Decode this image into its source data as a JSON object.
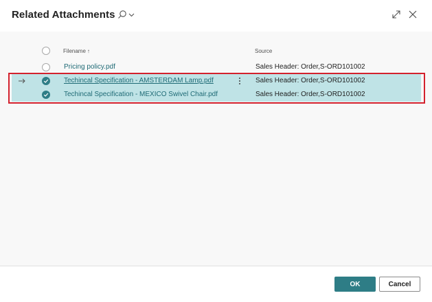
{
  "dialog": {
    "title": "Related Attachments",
    "search_icon": "search-icon",
    "search_dropdown_icon": "chevron-down-icon",
    "expand_icon": "expand-icon",
    "close_icon": "close-icon"
  },
  "table": {
    "columns": {
      "filename": "Filename",
      "filename_sort_icon": "↑",
      "source": "Source"
    },
    "rows": [
      {
        "filename": "Pricing policy.pdf",
        "source": "Sales Header: Order,S-ORD101002",
        "selected": false,
        "current": false
      },
      {
        "filename": "Techincal Specification - AMSTERDAM Lamp.pdf",
        "source": "Sales Header: Order,S-ORD101002",
        "selected": true,
        "current": true
      },
      {
        "filename": "Techincal Specification - MEXICO Swivel Chair.pdf",
        "source": "Sales Header: Order,S-ORD101002",
        "selected": true,
        "current": false
      }
    ]
  },
  "footer": {
    "ok_label": "OK",
    "cancel_label": "Cancel"
  },
  "colors": {
    "accent": "#2e7d86",
    "selected_row": "#bfe3e6",
    "highlight_border": "#d3212d",
    "link": "#1e6a75"
  }
}
